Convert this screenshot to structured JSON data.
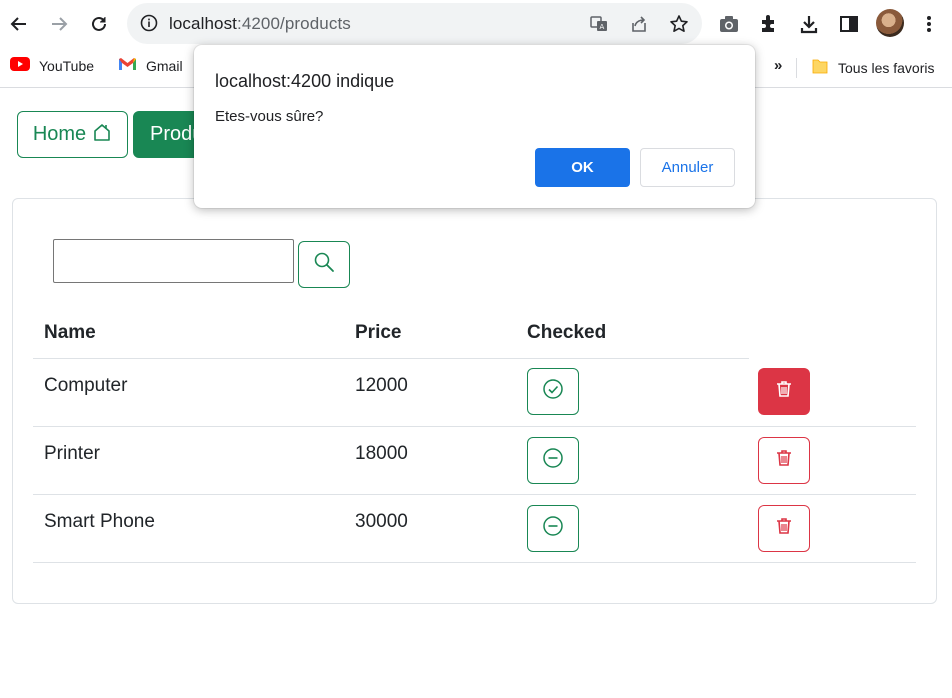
{
  "browser": {
    "url_host": "localhost",
    "url_path": ":4200/products",
    "icons": [
      "back-icon",
      "forward-icon",
      "reload-icon",
      "info-icon",
      "translate-icon",
      "share-icon",
      "star-icon",
      "camera-icon",
      "extensions-icon",
      "download-icon",
      "sidepanel-icon",
      "profile-avatar",
      "menu-icon"
    ]
  },
  "bookmarks": {
    "items": [
      {
        "label": "YouTube",
        "icon": "youtube-icon"
      },
      {
        "label": "Gmail",
        "icon": "gmail-icon"
      }
    ],
    "more": "»",
    "all_bookmarks": "Tous les favoris"
  },
  "nav": {
    "home_label": "Home",
    "products_label": "Products"
  },
  "search": {
    "value": "",
    "placeholder": ""
  },
  "table": {
    "headers": [
      "Name",
      "Price",
      "Checked"
    ],
    "rows": [
      {
        "name": "Computer",
        "price": "12000",
        "checked": true
      },
      {
        "name": "Printer",
        "price": "18000",
        "checked": false
      },
      {
        "name": "Smart Phone",
        "price": "30000",
        "checked": false
      }
    ]
  },
  "dialog": {
    "title": "localhost:4200 indique",
    "message": "Etes-vous sûre?",
    "ok_label": "OK",
    "cancel_label": "Annuler"
  },
  "colors": {
    "success": "#198754",
    "danger": "#dc3545",
    "dialog_primary": "#1a73e8"
  }
}
